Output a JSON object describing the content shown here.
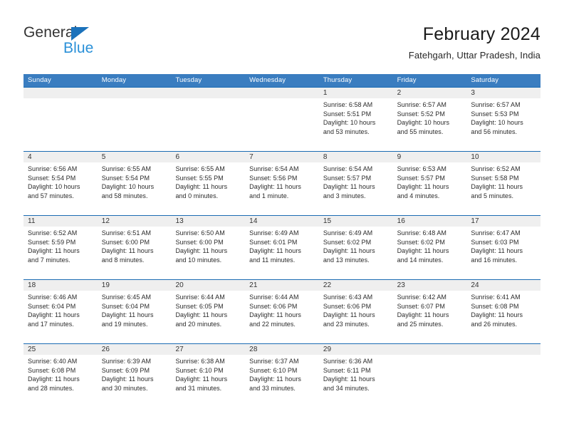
{
  "logo": {
    "word_1": "General",
    "word_2": "Blue",
    "triangle_icon": "triangle-icon",
    "color_dark": "#333333",
    "color_blue": "#2a90d8",
    "color_triangle": "#1b72bb"
  },
  "header": {
    "title": "February 2024",
    "subtitle": "Fatehgarh, Uttar Pradesh, India"
  },
  "theme": {
    "header_bg": "#3a7dc0",
    "row_border": "#1b6cb3",
    "daynum_bg": "#efefef",
    "text": "#2b2b2b"
  },
  "weekdays": [
    "Sunday",
    "Monday",
    "Tuesday",
    "Wednesday",
    "Thursday",
    "Friday",
    "Saturday"
  ],
  "weeks": [
    [
      {
        "day": "",
        "empty": true,
        "sunrise": "",
        "sunset": "",
        "daylight_1": "",
        "daylight_2": ""
      },
      {
        "day": "",
        "empty": true,
        "sunrise": "",
        "sunset": "",
        "daylight_1": "",
        "daylight_2": ""
      },
      {
        "day": "",
        "empty": true,
        "sunrise": "",
        "sunset": "",
        "daylight_1": "",
        "daylight_2": ""
      },
      {
        "day": "",
        "empty": true,
        "sunrise": "",
        "sunset": "",
        "daylight_1": "",
        "daylight_2": ""
      },
      {
        "day": "1",
        "sunrise": "Sunrise: 6:58 AM",
        "sunset": "Sunset: 5:51 PM",
        "daylight_1": "Daylight: 10 hours",
        "daylight_2": "and 53 minutes."
      },
      {
        "day": "2",
        "sunrise": "Sunrise: 6:57 AM",
        "sunset": "Sunset: 5:52 PM",
        "daylight_1": "Daylight: 10 hours",
        "daylight_2": "and 55 minutes."
      },
      {
        "day": "3",
        "sunrise": "Sunrise: 6:57 AM",
        "sunset": "Sunset: 5:53 PM",
        "daylight_1": "Daylight: 10 hours",
        "daylight_2": "and 56 minutes."
      }
    ],
    [
      {
        "day": "4",
        "sunrise": "Sunrise: 6:56 AM",
        "sunset": "Sunset: 5:54 PM",
        "daylight_1": "Daylight: 10 hours",
        "daylight_2": "and 57 minutes."
      },
      {
        "day": "5",
        "sunrise": "Sunrise: 6:55 AM",
        "sunset": "Sunset: 5:54 PM",
        "daylight_1": "Daylight: 10 hours",
        "daylight_2": "and 58 minutes."
      },
      {
        "day": "6",
        "sunrise": "Sunrise: 6:55 AM",
        "sunset": "Sunset: 5:55 PM",
        "daylight_1": "Daylight: 11 hours",
        "daylight_2": "and 0 minutes."
      },
      {
        "day": "7",
        "sunrise": "Sunrise: 6:54 AM",
        "sunset": "Sunset: 5:56 PM",
        "daylight_1": "Daylight: 11 hours",
        "daylight_2": "and 1 minute."
      },
      {
        "day": "8",
        "sunrise": "Sunrise: 6:54 AM",
        "sunset": "Sunset: 5:57 PM",
        "daylight_1": "Daylight: 11 hours",
        "daylight_2": "and 3 minutes."
      },
      {
        "day": "9",
        "sunrise": "Sunrise: 6:53 AM",
        "sunset": "Sunset: 5:57 PM",
        "daylight_1": "Daylight: 11 hours",
        "daylight_2": "and 4 minutes."
      },
      {
        "day": "10",
        "sunrise": "Sunrise: 6:52 AM",
        "sunset": "Sunset: 5:58 PM",
        "daylight_1": "Daylight: 11 hours",
        "daylight_2": "and 5 minutes."
      }
    ],
    [
      {
        "day": "11",
        "sunrise": "Sunrise: 6:52 AM",
        "sunset": "Sunset: 5:59 PM",
        "daylight_1": "Daylight: 11 hours",
        "daylight_2": "and 7 minutes."
      },
      {
        "day": "12",
        "sunrise": "Sunrise: 6:51 AM",
        "sunset": "Sunset: 6:00 PM",
        "daylight_1": "Daylight: 11 hours",
        "daylight_2": "and 8 minutes."
      },
      {
        "day": "13",
        "sunrise": "Sunrise: 6:50 AM",
        "sunset": "Sunset: 6:00 PM",
        "daylight_1": "Daylight: 11 hours",
        "daylight_2": "and 10 minutes."
      },
      {
        "day": "14",
        "sunrise": "Sunrise: 6:49 AM",
        "sunset": "Sunset: 6:01 PM",
        "daylight_1": "Daylight: 11 hours",
        "daylight_2": "and 11 minutes."
      },
      {
        "day": "15",
        "sunrise": "Sunrise: 6:49 AM",
        "sunset": "Sunset: 6:02 PM",
        "daylight_1": "Daylight: 11 hours",
        "daylight_2": "and 13 minutes."
      },
      {
        "day": "16",
        "sunrise": "Sunrise: 6:48 AM",
        "sunset": "Sunset: 6:02 PM",
        "daylight_1": "Daylight: 11 hours",
        "daylight_2": "and 14 minutes."
      },
      {
        "day": "17",
        "sunrise": "Sunrise: 6:47 AM",
        "sunset": "Sunset: 6:03 PM",
        "daylight_1": "Daylight: 11 hours",
        "daylight_2": "and 16 minutes."
      }
    ],
    [
      {
        "day": "18",
        "sunrise": "Sunrise: 6:46 AM",
        "sunset": "Sunset: 6:04 PM",
        "daylight_1": "Daylight: 11 hours",
        "daylight_2": "and 17 minutes."
      },
      {
        "day": "19",
        "sunrise": "Sunrise: 6:45 AM",
        "sunset": "Sunset: 6:04 PM",
        "daylight_1": "Daylight: 11 hours",
        "daylight_2": "and 19 minutes."
      },
      {
        "day": "20",
        "sunrise": "Sunrise: 6:44 AM",
        "sunset": "Sunset: 6:05 PM",
        "daylight_1": "Daylight: 11 hours",
        "daylight_2": "and 20 minutes."
      },
      {
        "day": "21",
        "sunrise": "Sunrise: 6:44 AM",
        "sunset": "Sunset: 6:06 PM",
        "daylight_1": "Daylight: 11 hours",
        "daylight_2": "and 22 minutes."
      },
      {
        "day": "22",
        "sunrise": "Sunrise: 6:43 AM",
        "sunset": "Sunset: 6:06 PM",
        "daylight_1": "Daylight: 11 hours",
        "daylight_2": "and 23 minutes."
      },
      {
        "day": "23",
        "sunrise": "Sunrise: 6:42 AM",
        "sunset": "Sunset: 6:07 PM",
        "daylight_1": "Daylight: 11 hours",
        "daylight_2": "and 25 minutes."
      },
      {
        "day": "24",
        "sunrise": "Sunrise: 6:41 AM",
        "sunset": "Sunset: 6:08 PM",
        "daylight_1": "Daylight: 11 hours",
        "daylight_2": "and 26 minutes."
      }
    ],
    [
      {
        "day": "25",
        "sunrise": "Sunrise: 6:40 AM",
        "sunset": "Sunset: 6:08 PM",
        "daylight_1": "Daylight: 11 hours",
        "daylight_2": "and 28 minutes."
      },
      {
        "day": "26",
        "sunrise": "Sunrise: 6:39 AM",
        "sunset": "Sunset: 6:09 PM",
        "daylight_1": "Daylight: 11 hours",
        "daylight_2": "and 30 minutes."
      },
      {
        "day": "27",
        "sunrise": "Sunrise: 6:38 AM",
        "sunset": "Sunset: 6:10 PM",
        "daylight_1": "Daylight: 11 hours",
        "daylight_2": "and 31 minutes."
      },
      {
        "day": "28",
        "sunrise": "Sunrise: 6:37 AM",
        "sunset": "Sunset: 6:10 PM",
        "daylight_1": "Daylight: 11 hours",
        "daylight_2": "and 33 minutes."
      },
      {
        "day": "29",
        "sunrise": "Sunrise: 6:36 AM",
        "sunset": "Sunset: 6:11 PM",
        "daylight_1": "Daylight: 11 hours",
        "daylight_2": "and 34 minutes."
      },
      {
        "day": "",
        "empty": true,
        "sunrise": "",
        "sunset": "",
        "daylight_1": "",
        "daylight_2": ""
      },
      {
        "day": "",
        "empty": true,
        "sunrise": "",
        "sunset": "",
        "daylight_1": "",
        "daylight_2": ""
      }
    ]
  ]
}
